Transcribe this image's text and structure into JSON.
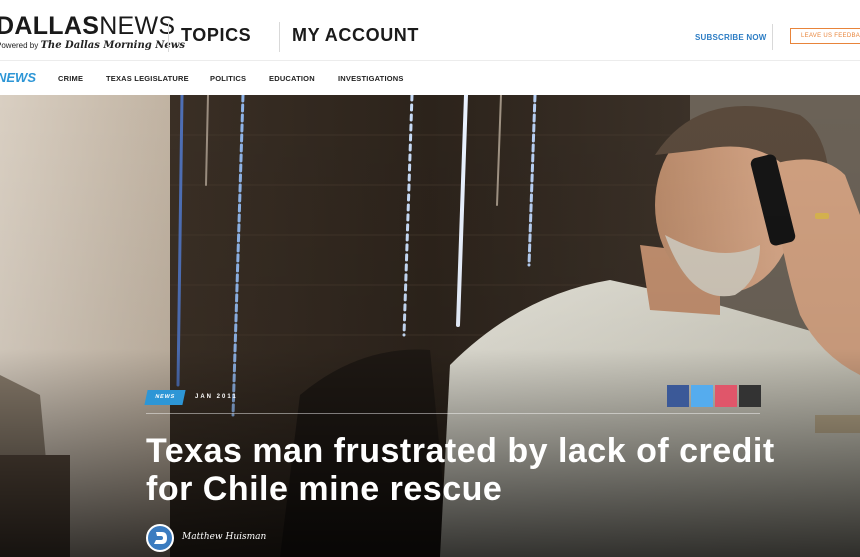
{
  "header": {
    "logo_bold": "DALLAS",
    "logo_light": "NEWS",
    "logo_sub_prefix": "Powered by",
    "logo_sub_brand": "The Dallas Morning News",
    "nav": [
      "TOPICS",
      "MY ACCOUNT"
    ],
    "subscribe": "SUBSCRIBE NOW",
    "feedback": "LEAVE US FEEDBACK"
  },
  "subnav": {
    "section": "NEWS",
    "items": [
      "CRIME",
      "TEXAS LEGISLATURE",
      "POLITICS",
      "EDUCATION",
      "INVESTIGATIONS"
    ]
  },
  "article": {
    "tag": "NEWS",
    "date": "JAN 2011",
    "headline": "Texas man frustrated by lack of credit for Chile mine rescue",
    "author": "Matthew Huisman",
    "share_colors": [
      "#3b5998",
      "#55acee",
      "#e0566a",
      "#333333"
    ]
  },
  "colors": {
    "accent": "#2d96d6",
    "feedback": "#e8843a",
    "subscribe": "#2d7dc4"
  },
  "icons": [
    "facebook-icon",
    "twitter-icon",
    "email-icon",
    "more-icon",
    "author-avatar-icon"
  ]
}
